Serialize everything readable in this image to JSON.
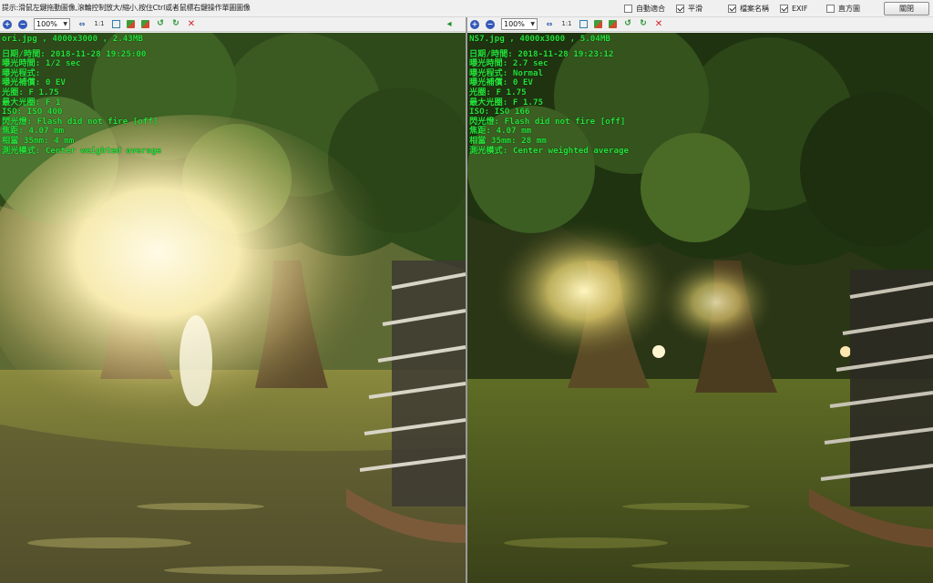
{
  "hint": "提示:滑鼠左鍵拖動圖像,滾輪控制放大/縮小,按住Ctrl或者鼠標右鍵操作單圖圖像",
  "options": [
    {
      "label": "自動適合",
      "checked": false
    },
    {
      "label": "平滑",
      "checked": true
    },
    {
      "label": "檔案名稱",
      "checked": true
    },
    {
      "label": "EXIF",
      "checked": true
    },
    {
      "label": "直方圖",
      "checked": false
    }
  ],
  "close_label": "關閉",
  "toolbar": {
    "zoom": "100%",
    "one_to_one": "1:1"
  },
  "left": {
    "file_line": "ori.jpg  , 4000x3000  , 2.43MB",
    "exif": [
      "日期/時間: 2018-11-28 19:25:00",
      "曝光時間: 1/2 sec",
      "曝光程式: ",
      "曝光補償: 0 EV",
      "光圈: F 1.75",
      "最大光圈: F 1",
      "ISO: ISO 400",
      "閃光燈: Flash did not fire [off]",
      "焦距: 4.07 mm",
      "相當 35mm: 4 mm",
      "測光模式: Center weighted average"
    ]
  },
  "right": {
    "file_line": "NS7.jpg  , 4000x3000  , 5.04MB",
    "exif": [
      "日期/時間: 2018-11-28 19:23:12",
      "曝光時間: 2.7 sec",
      "曝光程式: Normal",
      "曝光補償: 0 EV",
      "光圈: F 1.75",
      "最大光圈: F 1.75",
      "ISO: ISO 166",
      "閃光燈: Flash did not fire [off]",
      "焦距: 4.07 mm",
      "相當 35mm: 28 mm",
      "測光模式: Center weighted average"
    ]
  },
  "colors": {
    "exif_text": "#27e23a",
    "grass": "#5b6e2c",
    "foliage": "#2f4a1a"
  }
}
